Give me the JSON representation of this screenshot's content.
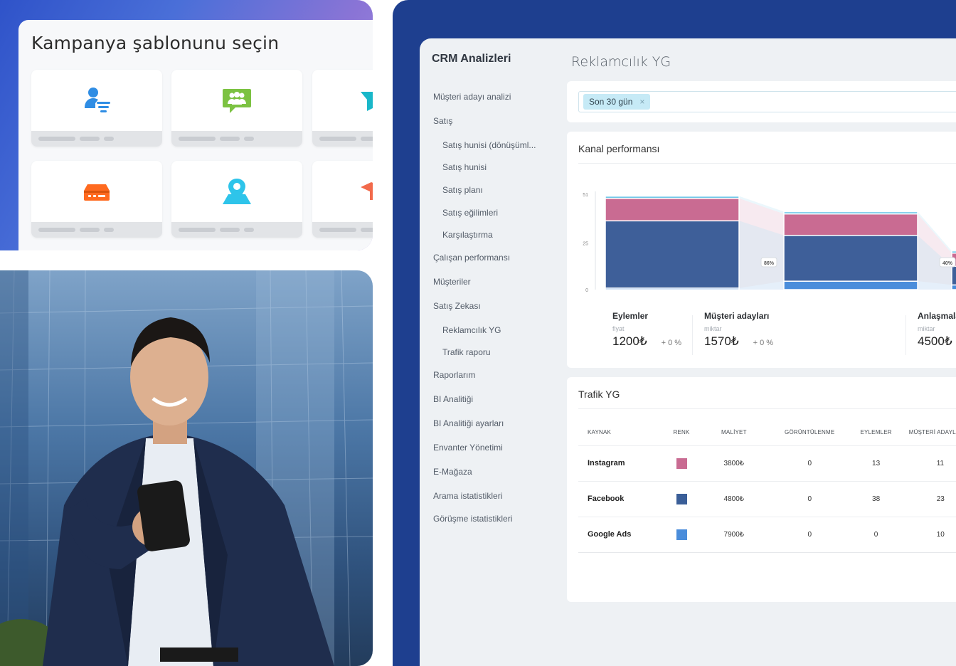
{
  "template_picker": {
    "title": "Kampanya şablonunu seçin",
    "tiles": [
      {
        "icon": "lead-filter-icon",
        "color": "#2f8de4"
      },
      {
        "icon": "group-chat-icon",
        "color": "#7cc242"
      },
      {
        "icon": "funnel-icon",
        "color": "#19b7c9"
      },
      {
        "icon": "inbox-tray-icon",
        "color": "#ff6a1f"
      },
      {
        "icon": "map-pin-icon",
        "color": "#2ec4ea"
      },
      {
        "icon": "graduation-cap-icon",
        "color": "#f26a4b"
      }
    ]
  },
  "photo": {
    "subject": "smiling-businessman-with-phone"
  },
  "crm": {
    "sidebar": {
      "title": "CRM Analizleri",
      "items": [
        {
          "label": "Müşteri adayı analizi",
          "level": "top"
        },
        {
          "label": "Satış",
          "level": "top"
        },
        {
          "label": "Satış hunisi (dönüşüml...",
          "level": "sub"
        },
        {
          "label": "Satış hunisi",
          "level": "sub"
        },
        {
          "label": "Satış planı",
          "level": "sub"
        },
        {
          "label": "Satış eğilimleri",
          "level": "sub"
        },
        {
          "label": "Karşılaştırma",
          "level": "sub"
        },
        {
          "label": "Çalışan performansı",
          "level": "top"
        },
        {
          "label": "Müşteriler",
          "level": "top"
        },
        {
          "label": "Satış Zekası",
          "level": "top"
        },
        {
          "label": "Reklamcılık YG",
          "level": "sub"
        },
        {
          "label": "Trafik raporu",
          "level": "sub"
        },
        {
          "label": "Raporlarım",
          "level": "top"
        },
        {
          "label": "BI Analitiği",
          "level": "top"
        },
        {
          "label": "BI Analitiği ayarları",
          "level": "top"
        },
        {
          "label": "Envanter Yönetimi",
          "level": "top"
        },
        {
          "label": "E-Mağaza",
          "level": "top"
        },
        {
          "label": "Arama istatistikleri",
          "level": "top"
        },
        {
          "label": "Görüşme istatistikleri",
          "level": "top"
        }
      ]
    },
    "page_title": "Reklamcılık YG",
    "filter": {
      "chip_label": "Son 30 gün",
      "chip_close": "×"
    },
    "kanal": {
      "title": "Kanal performansı",
      "kpis": [
        {
          "name": "Eylemler",
          "sub": "fiyat",
          "value": "1200₺",
          "change": "+ 0 %"
        },
        {
          "name": "Müşteri adayları",
          "sub": "miktar",
          "value": "1570₺",
          "change": "+ 0 %"
        },
        {
          "name": "Anlaşmalar",
          "sub": "miktar",
          "value": "4500₺",
          "change": ""
        }
      ]
    },
    "trafik": {
      "title": "Trafik YG",
      "columns": [
        "KAYNAK",
        "RENK",
        "MALİYET",
        "GÖRÜNTÜLENME",
        "EYLEMLER",
        "MÜŞTERİ ADAYLARI"
      ],
      "rows": [
        {
          "source": "Instagram",
          "color": "#c96b92",
          "cost": "3800₺",
          "views": "0",
          "actions": "13",
          "leads": "11"
        },
        {
          "source": "Facebook",
          "color": "#3a5e98",
          "cost": "4800₺",
          "views": "0",
          "actions": "38",
          "leads": "23"
        },
        {
          "source": "Google Ads",
          "color": "#4a8ddb",
          "cost": "7900₺",
          "views": "0",
          "actions": "0",
          "leads": "10"
        }
      ]
    }
  },
  "chart_data": {
    "type": "bar",
    "stacked": true,
    "categories": [
      "Eylemler",
      "Müşteri adayları",
      "Anlaşmalar"
    ],
    "series": [
      {
        "values": [
          0.8,
          4.5,
          2.5
        ],
        "color": "#4a8ddb"
      },
      {
        "values": [
          36,
          24.5,
          10
        ],
        "color": "#3e5f99"
      },
      {
        "values": [
          12,
          11.5,
          7
        ],
        "color": "#c96b92"
      },
      {
        "values": [
          1.2,
          1.2,
          1.2
        ],
        "color": "#6fc7e8"
      }
    ],
    "ylim": [
      0,
      51
    ],
    "yticks": [
      0,
      25,
      51
    ],
    "conversion_labels": [
      "86%",
      "40%"
    ],
    "grid": false,
    "legend": "none"
  }
}
